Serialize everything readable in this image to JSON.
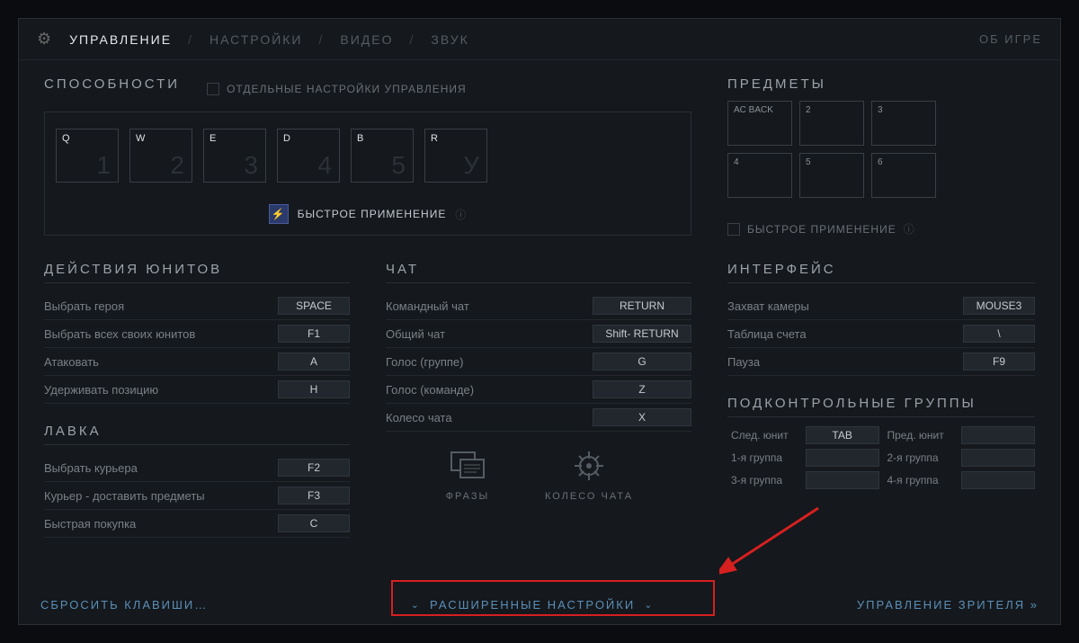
{
  "topbar": {
    "tabs": [
      "УПРАВЛЕНИЕ",
      "НАСТРОЙКИ",
      "ВИДЕО",
      "ЗВУК"
    ],
    "about": "ОБ ИГРЕ"
  },
  "abilities": {
    "title": "СПОСОБНОСТИ",
    "separate_label": "ОТДЕЛЬНЫЕ НАСТРОЙКИ УПРАВЛЕНИЯ",
    "keys": [
      {
        "key": "Q",
        "index": "1"
      },
      {
        "key": "W",
        "index": "2"
      },
      {
        "key": "E",
        "index": "3"
      },
      {
        "key": "D",
        "index": "4"
      },
      {
        "key": "B",
        "index": "5"
      },
      {
        "key": "R",
        "index": "У"
      }
    ],
    "quickcast": "БЫСТРОЕ ПРИМЕНЕНИЕ"
  },
  "items": {
    "title": "ПРЕДМЕТЫ",
    "keys": [
      "AC BACK",
      "2",
      "3",
      "4",
      "5",
      "6"
    ],
    "quickcast": "БЫСТРОЕ ПРИМЕНЕНИЕ"
  },
  "unit_actions": {
    "title": "ДЕЙСТВИЯ ЮНИТОВ",
    "rows": [
      {
        "label": "Выбрать героя",
        "key": "SPACE"
      },
      {
        "label": "Выбрать всех своих юнитов",
        "key": "F1"
      },
      {
        "label": "Атаковать",
        "key": "A"
      },
      {
        "label": "Удерживать позицию",
        "key": "H"
      }
    ]
  },
  "shop": {
    "title": "ЛАВКА",
    "rows": [
      {
        "label": "Выбрать курьера",
        "key": "F2"
      },
      {
        "label": "Курьер - доставить предметы",
        "key": "F3"
      },
      {
        "label": "Быстрая покупка",
        "key": "C"
      }
    ]
  },
  "chat": {
    "title": "ЧАТ",
    "rows": [
      {
        "label": "Командный чат",
        "key": "RETURN"
      },
      {
        "label": "Общий чат",
        "key": "Shift- RETURN"
      },
      {
        "label": "Голос (группе)",
        "key": "G"
      },
      {
        "label": "Голос (команде)",
        "key": "Z"
      },
      {
        "label": "Колесо чата",
        "key": "X"
      }
    ],
    "phrases": "ФРАЗЫ",
    "wheel": "КОЛЕСО ЧАТА"
  },
  "interface": {
    "title": "ИНТЕРФЕЙС",
    "rows": [
      {
        "label": "Захват камеры",
        "key": "MOUSE3"
      },
      {
        "label": "Таблица счета",
        "key": "\\"
      },
      {
        "label": "Пауза",
        "key": "F9"
      }
    ]
  },
  "groups": {
    "title": "ПОДКОНТРОЛЬНЫЕ ГРУППЫ",
    "next_label": "След. юнит",
    "next_key": "TAB",
    "prev_label": "Пред. юнит",
    "prev_key": "",
    "g1": "1-я группа",
    "g1k": "",
    "g2": "2-я группа",
    "g2k": "",
    "g3": "3-я группа",
    "g3k": "",
    "g4": "4-я группа",
    "g4k": ""
  },
  "footer": {
    "reset": "СБРОСИТЬ КЛАВИШИ…",
    "advanced": "РАСШИРЕННЫЕ НАСТРОЙКИ",
    "spectator": "УПРАВЛЕНИЕ ЗРИТЕЛЯ"
  }
}
